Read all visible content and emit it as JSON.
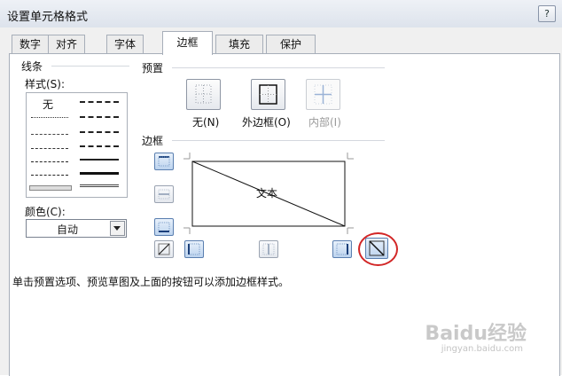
{
  "window": {
    "title": "设置单元格格式",
    "help_label": "?"
  },
  "tabs": [
    "数字",
    "对齐",
    "字体",
    "边框",
    "填充",
    "保护"
  ],
  "active_tab": "边框",
  "line_group": {
    "title": "线条",
    "style_label": "样式(S):",
    "none_label": "无",
    "color_label": "颜色(C):",
    "color_value": "自动"
  },
  "presets": {
    "title": "预置",
    "items": [
      {
        "label": "无(N)",
        "icon": "preset-none-icon",
        "enabled": true
      },
      {
        "label": "外边框(O)",
        "icon": "preset-outline-icon",
        "enabled": true
      },
      {
        "label": "内部(I)",
        "icon": "preset-inside-icon",
        "enabled": false
      }
    ]
  },
  "border": {
    "title": "边框",
    "preview_text": "文本",
    "diagonal_down_active": true
  },
  "hint": "单击预置选项、预览草图及上面的按钮可以添加边框样式。",
  "watermark": {
    "text": "Baidu经验",
    "sub": "jingyan.baidu.com"
  },
  "colors": {
    "accent": "#5a7fb0",
    "highlight_circle": "#d22626"
  }
}
